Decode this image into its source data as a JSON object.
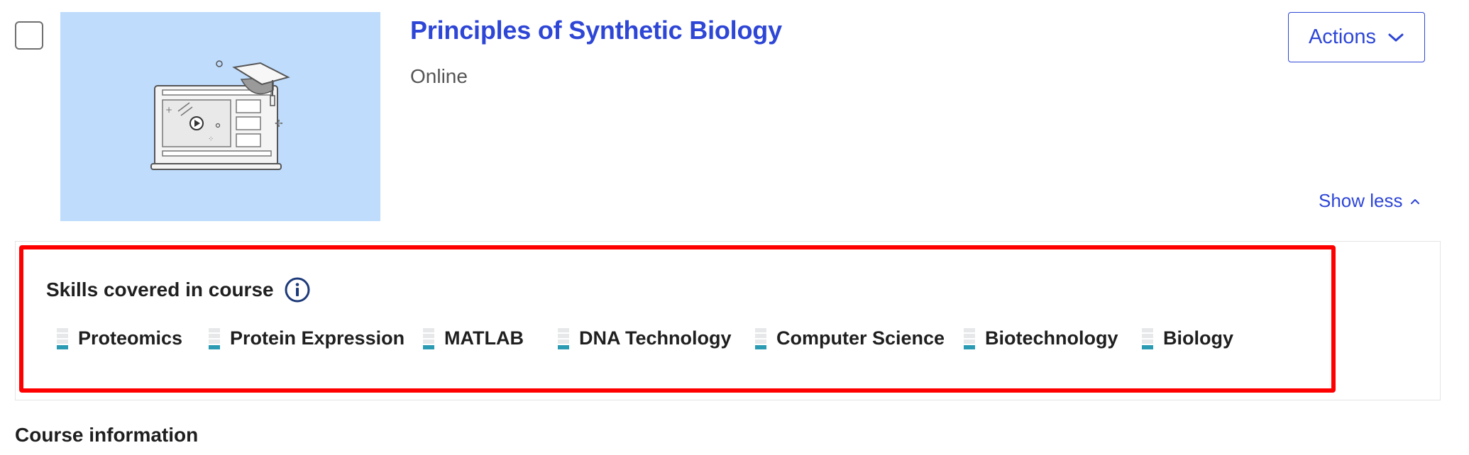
{
  "course": {
    "title": "Principles of Synthetic Biology",
    "format": "Online"
  },
  "actions": {
    "label": "Actions",
    "icon": "chevron-down-icon"
  },
  "show_less": {
    "label": "Show less",
    "icon": "chevron-up-icon"
  },
  "skills": {
    "heading": "Skills covered in course",
    "info_icon": "info-icon",
    "items": [
      {
        "label": "Proteomics",
        "level": 1
      },
      {
        "label": "Protein Expression",
        "level": 1
      },
      {
        "label": "MATLAB",
        "level": 1
      },
      {
        "label": "DNA Technology",
        "level": 1
      },
      {
        "label": "Computer Science",
        "level": 1
      },
      {
        "label": "Biotechnology",
        "level": 1
      },
      {
        "label": "Biology",
        "level": 1
      }
    ]
  },
  "course_information_heading": "Course information",
  "colors": {
    "link": "#2e46d6",
    "thumbnail_bg": "#bfdcfd",
    "highlight_border": "#ff0000",
    "skill_level": "#2a9bb3"
  }
}
